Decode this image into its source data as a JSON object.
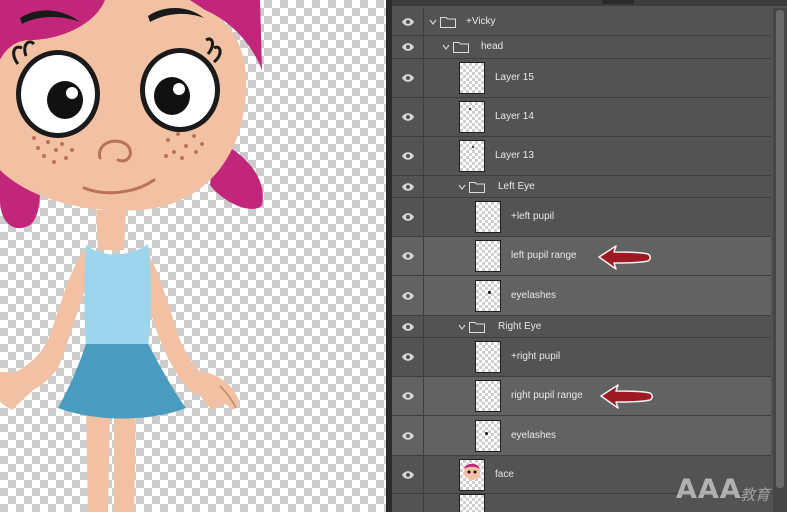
{
  "colors": {
    "panel_bg": "#535353",
    "row_selected": "#626262",
    "arrow": "#9e1a22",
    "hair": "#c2267a",
    "skin": "#f2c1a3",
    "shirt": "#9dd5ec",
    "skirt": "#4a9bc0"
  },
  "layers": {
    "vicky_group": "+Vicky",
    "head_group": "head",
    "layer15": "Layer 15",
    "layer14": "Layer 14",
    "layer13": "Layer 13",
    "left_eye_group": "Left Eye",
    "left_pupil": "+left pupil",
    "left_pupil_range": "left pupil range",
    "left_eyelashes": "eyelashes",
    "right_eye_group": "Right Eye",
    "right_pupil": "+right pupil",
    "right_pupil_range": "right pupil range",
    "right_eyelashes": "eyelashes",
    "face": "face"
  },
  "watermark": {
    "main": "AAA",
    "sub": "教育"
  }
}
